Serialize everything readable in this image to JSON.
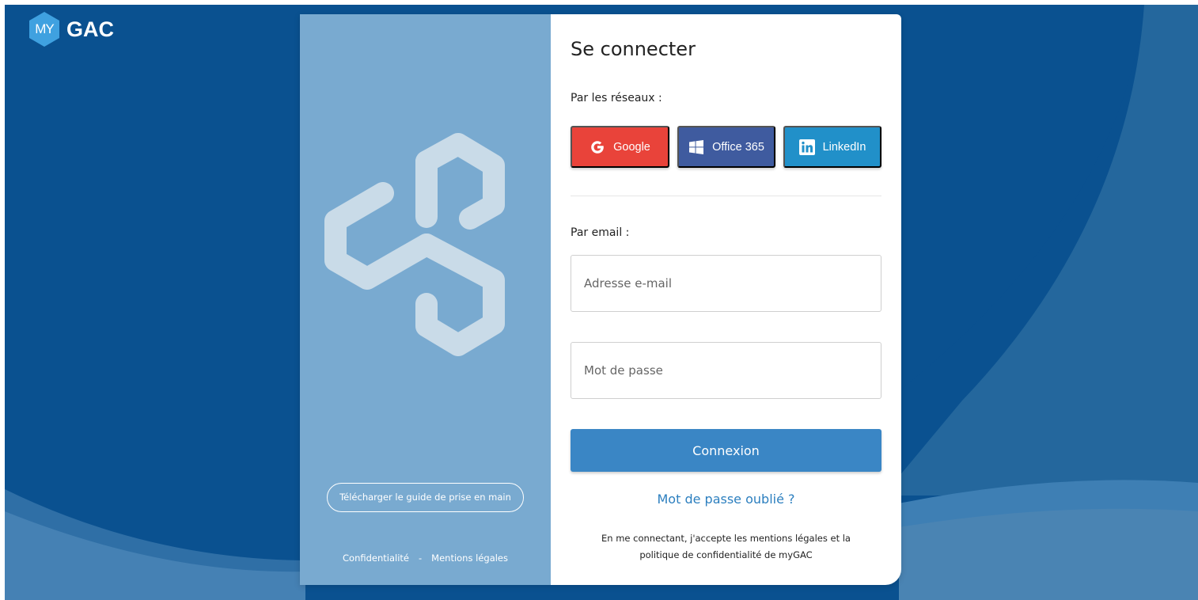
{
  "brand": {
    "badge_text": "MY",
    "name": "GAC"
  },
  "colors": {
    "background": "#0a5190",
    "left_panel": "#79aad0",
    "google": "#e9433a",
    "office": "#3f5b9f",
    "linkedin": "#2190c9",
    "primary": "#3a86c5",
    "link": "#2c7fbf"
  },
  "left_panel": {
    "guide_button_label": "Télécharger le guide de prise en main",
    "links": {
      "privacy": "Confidentialité",
      "separator": "-",
      "legal": "Mentions légales"
    }
  },
  "login": {
    "title": "Se connecter",
    "networks_label": "Par les réseaux :",
    "social": [
      {
        "label": "Google",
        "icon": "google-icon"
      },
      {
        "label": "Office 365",
        "icon": "windows-icon"
      },
      {
        "label": "LinkedIn",
        "icon": "linkedin-icon"
      }
    ],
    "email_label": "Par email :",
    "email_placeholder": "Adresse e-mail",
    "password_placeholder": "Mot de passe",
    "submit_label": "Connexion",
    "forgot_label": "Mot de passe oublié ?",
    "legal_line1": "En me connectant, j'accepte les mentions légales et la",
    "legal_line2": "politique de confidentialité de myGAC"
  }
}
